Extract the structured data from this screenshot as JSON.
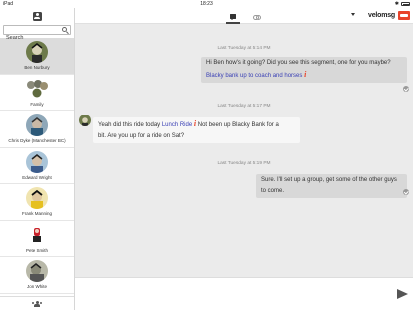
{
  "status_bar": {
    "carrier": "iPad",
    "time": "18:23",
    "bluetooth": "✱"
  },
  "sidebar": {
    "search_placeholder": "Search",
    "contacts": [
      {
        "name": "Ben Nurbury",
        "selected": true
      },
      {
        "name": "Family",
        "selected": false
      },
      {
        "name": "Chris Dyke (Manchester BC)",
        "selected": false
      },
      {
        "name": "Edward Wright",
        "selected": false
      },
      {
        "name": "Frank Manning",
        "selected": false
      },
      {
        "name": "Pete Smith",
        "selected": false
      },
      {
        "name": "Jon White",
        "selected": false
      }
    ]
  },
  "topbar": {
    "brand": "velomsg"
  },
  "chat": {
    "messages": [
      {
        "timestamp": "Last Tuesday at 5:14 PM",
        "direction": "outgoing",
        "line1": "Hi Ben how's it going? Did you see this segment, one for you maybe?",
        "link": "Blacky bank up to coach and horses",
        "info": "i"
      },
      {
        "timestamp": "Last Tuesday at 5:17 PM",
        "direction": "incoming",
        "prefix": "Yeah did this ride today",
        "link": "Lunch Ride",
        "info": "i",
        "suffix": "Not been up Blacky Bank for a",
        "line2": "bit. Are you up for a ride on Sat?"
      },
      {
        "timestamp": "Last Tuesday at 5:19 PM",
        "direction": "outgoing",
        "text": "Sure. I'll set up a group, get some of the other guys to come."
      }
    ]
  },
  "composer": {
    "placeholder": ""
  },
  "colors": {
    "accent": "#e8432b",
    "link": "#3a40b5",
    "outgoing_bubble": "#d8d8d8",
    "incoming_bubble": "#f7f7f7"
  }
}
